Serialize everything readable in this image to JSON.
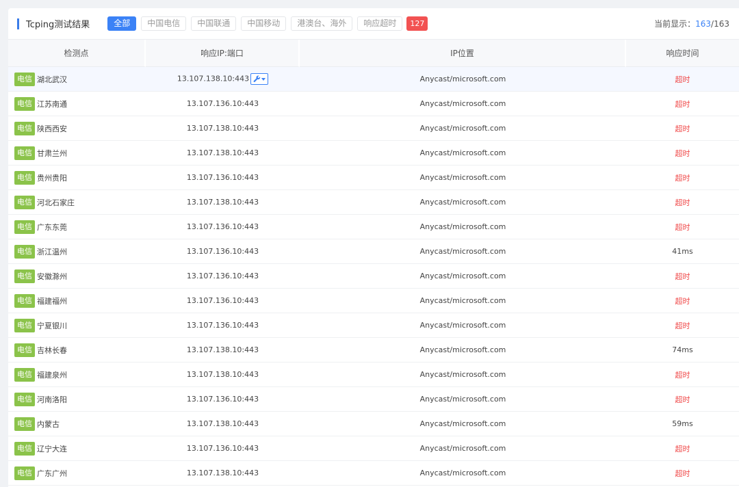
{
  "header": {
    "title": "Tcping测试结果",
    "filters": [
      {
        "label": "全部",
        "active": true
      },
      {
        "label": "中国电信",
        "active": false
      },
      {
        "label": "中国联通",
        "active": false
      },
      {
        "label": "中国移动",
        "active": false
      },
      {
        "label": "港澳台、海外",
        "active": false
      },
      {
        "label": "响应超时",
        "active": false
      }
    ],
    "timeout_count": "127",
    "display_label": "当前显示：",
    "display_current": "163",
    "display_total": "/163"
  },
  "table": {
    "columns": [
      "检测点",
      "响应IP:端口",
      "IP位置",
      "响应时间"
    ],
    "rows": [
      {
        "isp": "电信",
        "location": "湖北武汉",
        "ip": "13.107.138.10:443",
        "geo": "Anycast/microsoft.com",
        "time": "超时",
        "timeout": true,
        "highlight": true,
        "tool": true
      },
      {
        "isp": "电信",
        "location": "江苏南通",
        "ip": "13.107.136.10:443",
        "geo": "Anycast/microsoft.com",
        "time": "超时",
        "timeout": true
      },
      {
        "isp": "电信",
        "location": "陕西西安",
        "ip": "13.107.138.10:443",
        "geo": "Anycast/microsoft.com",
        "time": "超时",
        "timeout": true
      },
      {
        "isp": "电信",
        "location": "甘肃兰州",
        "ip": "13.107.138.10:443",
        "geo": "Anycast/microsoft.com",
        "time": "超时",
        "timeout": true
      },
      {
        "isp": "电信",
        "location": "贵州贵阳",
        "ip": "13.107.136.10:443",
        "geo": "Anycast/microsoft.com",
        "time": "超时",
        "timeout": true
      },
      {
        "isp": "电信",
        "location": "河北石家庄",
        "ip": "13.107.138.10:443",
        "geo": "Anycast/microsoft.com",
        "time": "超时",
        "timeout": true
      },
      {
        "isp": "电信",
        "location": "广东东莞",
        "ip": "13.107.136.10:443",
        "geo": "Anycast/microsoft.com",
        "time": "超时",
        "timeout": true
      },
      {
        "isp": "电信",
        "location": "浙江温州",
        "ip": "13.107.136.10:443",
        "geo": "Anycast/microsoft.com",
        "time": "41ms",
        "timeout": false
      },
      {
        "isp": "电信",
        "location": "安徽滁州",
        "ip": "13.107.136.10:443",
        "geo": "Anycast/microsoft.com",
        "time": "超时",
        "timeout": true
      },
      {
        "isp": "电信",
        "location": "福建福州",
        "ip": "13.107.136.10:443",
        "geo": "Anycast/microsoft.com",
        "time": "超时",
        "timeout": true
      },
      {
        "isp": "电信",
        "location": "宁夏银川",
        "ip": "13.107.136.10:443",
        "geo": "Anycast/microsoft.com",
        "time": "超时",
        "timeout": true
      },
      {
        "isp": "电信",
        "location": "吉林长春",
        "ip": "13.107.138.10:443",
        "geo": "Anycast/microsoft.com",
        "time": "74ms",
        "timeout": false
      },
      {
        "isp": "电信",
        "location": "福建泉州",
        "ip": "13.107.138.10:443",
        "geo": "Anycast/microsoft.com",
        "time": "超时",
        "timeout": true
      },
      {
        "isp": "电信",
        "location": "河南洛阳",
        "ip": "13.107.136.10:443",
        "geo": "Anycast/microsoft.com",
        "time": "超时",
        "timeout": true
      },
      {
        "isp": "电信",
        "location": "内蒙古",
        "ip": "13.107.138.10:443",
        "geo": "Anycast/microsoft.com",
        "time": "59ms",
        "timeout": false
      },
      {
        "isp": "电信",
        "location": "辽宁大连",
        "ip": "13.107.136.10:443",
        "geo": "Anycast/microsoft.com",
        "time": "超时",
        "timeout": true
      },
      {
        "isp": "电信",
        "location": "广东广州",
        "ip": "13.107.138.10:443",
        "geo": "Anycast/microsoft.com",
        "time": "超时",
        "timeout": true
      }
    ]
  },
  "colors": {
    "accent": "#3b82f6",
    "isp_tag": "#8bc34a",
    "timeout_text": "#f04b4b",
    "timeout_badge": "#f25252"
  },
  "icons": {
    "tool": "wrench-icon",
    "dropdown": "caret-down-icon"
  }
}
